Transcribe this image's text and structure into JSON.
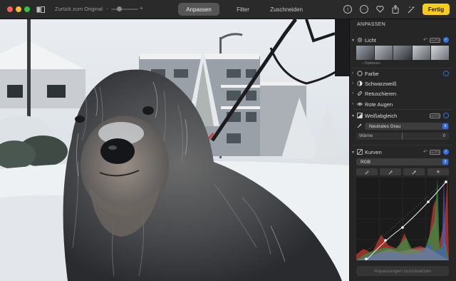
{
  "window": {
    "traffic_lights": {
      "close": "#ff5f57",
      "minimize": "#febc2e",
      "zoom": "#28c840"
    }
  },
  "toolbar": {
    "view_toggle_icon": "split-view-icon",
    "back_label": "Zurück zum Original",
    "zoom_slider_level": 0.3,
    "tabs": [
      {
        "label": "Anpassen",
        "active": true
      },
      {
        "label": "Filter",
        "active": false
      },
      {
        "label": "Zuschneiden",
        "active": false
      }
    ],
    "icons": [
      "info-icon",
      "more-icon",
      "favorite-icon",
      "share-icon",
      "rotate-icon",
      "enhance-icon"
    ],
    "done_label": "Fertig",
    "accent": "#f7cc1b"
  },
  "sidebar": {
    "title": "ANPASSEN",
    "accent": "#2f6fe0",
    "sections": {
      "licht": {
        "label": "Licht",
        "auto": "AUTO",
        "options_label": "Optionen"
      },
      "farbe": {
        "label": "Farbe"
      },
      "schwarzweiss": {
        "label": "Schwarzweiß"
      },
      "retuschieren": {
        "label": "Retuschieren"
      },
      "rote_augen": {
        "label": "Rote Augen"
      },
      "weissabgleich": {
        "label": "Weißabgleich",
        "auto": "AUTO",
        "preset": "Neutrales Grau",
        "warmth_label": "Wärme",
        "warmth_value": "0"
      },
      "kurven": {
        "label": "Kurven",
        "auto": "AUTO",
        "channel": "RGB",
        "add_point_label": "+"
      }
    },
    "reset_label": "Anpassungen zurücksetzen"
  }
}
